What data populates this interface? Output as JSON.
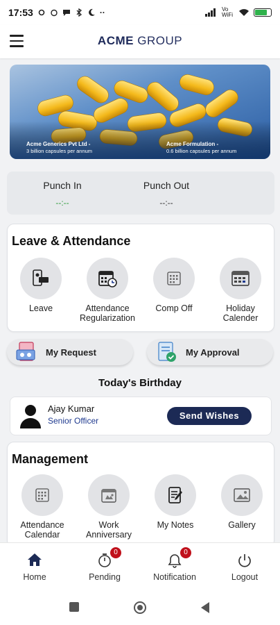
{
  "status_bar": {
    "time": "17:53",
    "network": "Vo WiFi",
    "battery_level": 0.8
  },
  "header": {
    "brand_bold": "ACME",
    "brand_rest": "GROUP"
  },
  "banner": {
    "left_caption_title": "Acme Generics Pvt Ltd -",
    "left_caption_sub": "3 billion capsules per annum",
    "right_caption_title": "Acme Formulation -",
    "right_caption_sub": "0.6 billion capsules per annum"
  },
  "punch": {
    "in_label": "Punch In",
    "in_value": "--:--",
    "out_label": "Punch Out",
    "out_value": "--:--"
  },
  "leave_attendance": {
    "title": "Leave & Attendance",
    "items": [
      {
        "label": "Leave",
        "icon": "leave-icon"
      },
      {
        "label": "Attendance Regularization",
        "icon": "calendar-clock-icon"
      },
      {
        "label": "Comp Off",
        "icon": "calendar-grid-icon"
      },
      {
        "label": "Holiday Calender",
        "icon": "calendar-icon"
      }
    ]
  },
  "requests": {
    "my_request": "My Request",
    "my_approval": "My Approval"
  },
  "birthday": {
    "title": "Today's Birthday",
    "name": "Ajay Kumar",
    "role": "Senior Officer",
    "button": "Send Wishes"
  },
  "management": {
    "title": "Management",
    "items": [
      {
        "label": "Attendance Calendar",
        "icon": "calendar-grid-icon"
      },
      {
        "label": "Work Anniversary",
        "icon": "anniversary-icon"
      },
      {
        "label": "My Notes",
        "icon": "notes-icon"
      },
      {
        "label": "Gallery",
        "icon": "gallery-icon"
      }
    ]
  },
  "bottom_nav": {
    "home": "Home",
    "pending": "Pending",
    "pending_count": "0",
    "notification": "Notification",
    "notification_count": "0",
    "logout": "Logout"
  },
  "colors": {
    "brand_navy": "#1c2a55",
    "badge_red": "#c0101b",
    "punch_green": "#2e9a3a"
  }
}
